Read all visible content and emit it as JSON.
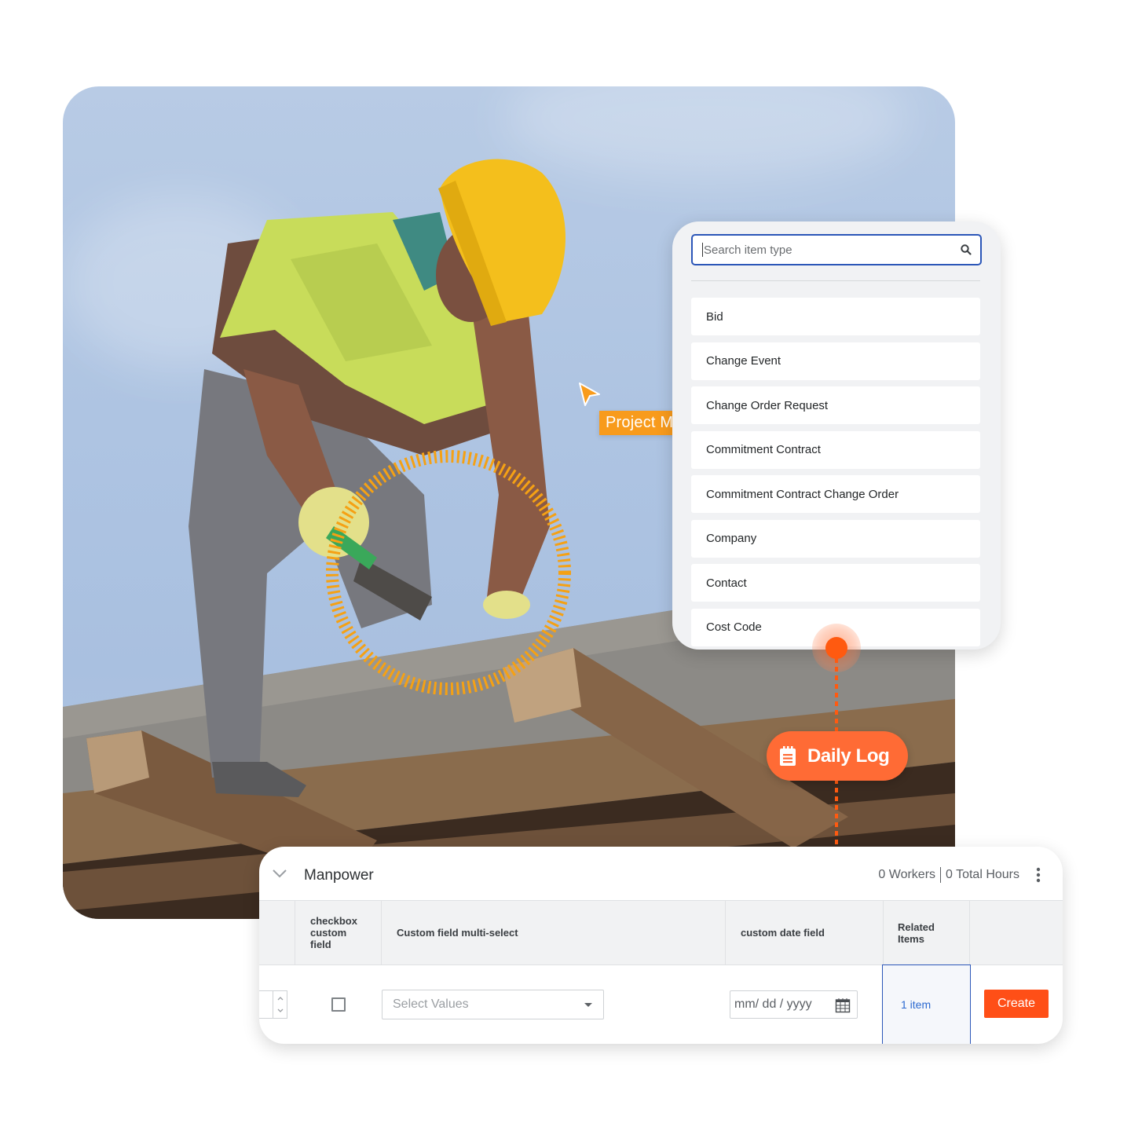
{
  "photo": {
    "subject": "construction worker in yellow hard hat and hi-vis vest hammering on wooden beams against blue sky"
  },
  "picker": {
    "search_placeholder": "Search item type",
    "search_icon": "search-icon",
    "items": [
      {
        "label": "Bid"
      },
      {
        "label": "Change Event"
      },
      {
        "label": "Change Order Request"
      },
      {
        "label": "Commitment Contract"
      },
      {
        "label": "Commitment Contract Change Order"
      },
      {
        "label": "Company"
      },
      {
        "label": "Contact"
      },
      {
        "label": "Cost Code"
      }
    ]
  },
  "cursor_tag": {
    "label": "Project Manager",
    "color": "#f89b1c"
  },
  "daily_log": {
    "label": "Daily Log",
    "icon": "clipboard-icon",
    "color": "#ff6b35"
  },
  "manpower": {
    "title": "Manpower",
    "workers": "0 Workers",
    "total_hours": "0 Total Hours",
    "columns": [
      {
        "label": "checkbox custom field"
      },
      {
        "label": "Custom field multi-select"
      },
      {
        "label": "custom date field"
      },
      {
        "label": "Related Items"
      }
    ],
    "row": {
      "checkbox_checked": false,
      "multiselect_placeholder": "Select Values",
      "date_placeholder": "mm/ dd / yyyy",
      "related_items": "1 item",
      "create_label": "Create"
    },
    "accent": "#ff4f17"
  }
}
